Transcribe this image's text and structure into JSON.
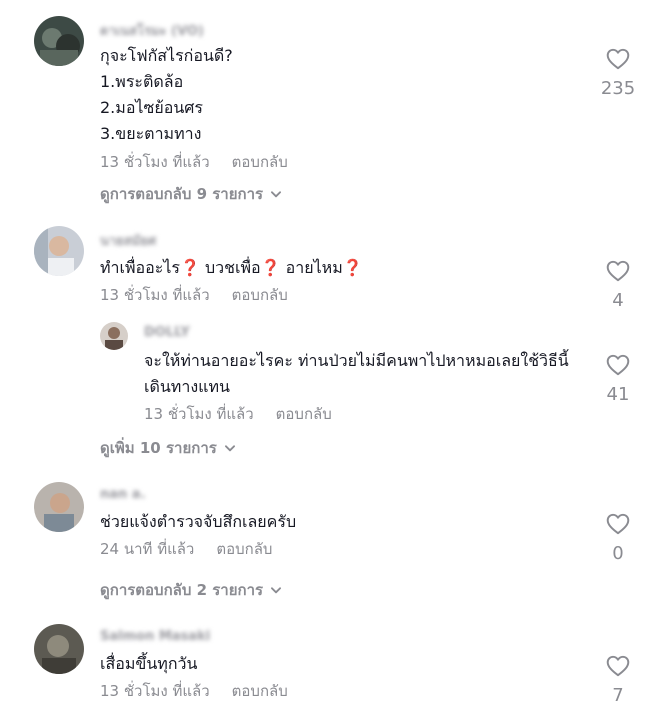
{
  "comments": [
    {
      "username": "ดาเนสโรมะ (VO)",
      "lines": [
        "กุจะโฟกัสไรก่อนดี?",
        "1.พระติดล้อ",
        "2.มอไซย้อนศร",
        "3.ขยะตามทาง"
      ],
      "time": "13 ชั่วโมง ที่แล้ว",
      "reply_label": "ตอบกลับ",
      "likes": "235",
      "view_replies": "ดูการตอบกลับ 9 รายการ"
    },
    {
      "username": "นายสมัยศ",
      "text_parts": [
        "ทำเพื่ออะไร",
        "❓",
        " บวชเพื่อ",
        "❓",
        " อายไหม",
        "❓"
      ],
      "time": "13 ชั่วโมง ที่แล้ว",
      "reply_label": "ตอบกลับ",
      "likes": "4",
      "reply": {
        "username": "DOLLY",
        "lines": [
          "จะให้ท่านอายอะไรคะ ท่านป่วยไม่มีคนพาไปหาหมอเลยใช้วิธีนี้",
          "เดินทางแทน"
        ],
        "time": "13 ชั่วโมง ที่แล้ว",
        "reply_label": "ตอบกลับ",
        "likes": "41"
      },
      "view_more": "ดูเพิ่ม 10 รายการ"
    },
    {
      "username": "nan a.",
      "text": "ช่วยแจ้งตำรวจจับสึกเลยครับ",
      "time": "24 นาที ที่แล้ว",
      "reply_label": "ตอบกลับ",
      "likes": "0",
      "view_replies": "ดูการตอบกลับ 2 รายการ"
    },
    {
      "username": "Salmon Masaki",
      "text": "เสื่อมขึ้นทุกวัน",
      "time": "13 ชั่วโมง ที่แล้ว",
      "reply_label": "ตอบกลับ",
      "likes": "7"
    }
  ],
  "colors": {
    "text": "#161823",
    "meta": "#8a8b91",
    "question_mark": "#e0263f",
    "background": "#ffffff"
  },
  "icons": {
    "like": "heart-outline-icon",
    "expand": "chevron-down-icon"
  }
}
